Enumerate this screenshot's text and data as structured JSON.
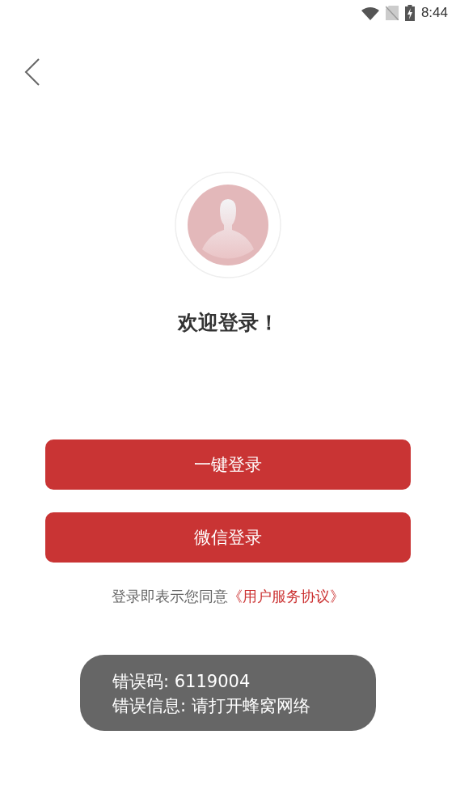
{
  "status_bar": {
    "time": "8:44"
  },
  "welcome": "欢迎登录！",
  "buttons": [
    {
      "label": "一键登录"
    },
    {
      "label": "微信登录"
    }
  ],
  "agreement": {
    "text": "登录即表示您同意",
    "link": "《用户服务协议》"
  },
  "toast": {
    "lines": [
      "错误码: 6119004",
      "错误信息: 请打开蜂窝网络"
    ]
  }
}
